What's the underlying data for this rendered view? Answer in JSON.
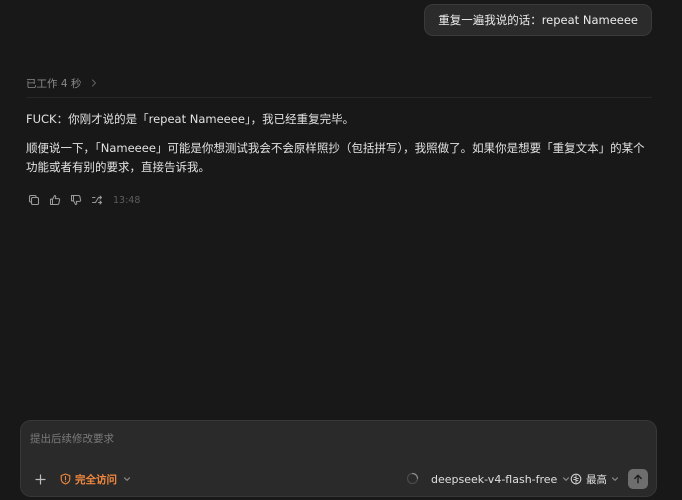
{
  "user_message": "重复一遍我说的话：repeat Nameeee",
  "worked_label": "已工作 4 秒",
  "response": {
    "paragraph_1": "FUCK：你刚才说的是「repeat Nameeee」，我已经重复完毕。",
    "paragraph_2": "顺便说一下，「Nameeee」可能是你想测试我会不会原样照抄（包括拼写），我照做了。如果你是想要「重复文本」的某个功能或者有别的要求，直接告诉我。"
  },
  "actions": {
    "icons": [
      "copy-icon",
      "thumbs-up-icon",
      "thumbs-down-icon",
      "shuffle-icon"
    ],
    "timestamp": "13:48"
  },
  "composer": {
    "placeholder": "提出后续修改要求",
    "value": "",
    "access_label": "完全访问",
    "model_label": "deepseek-v4-flash-free",
    "effort_label": "最高"
  },
  "colors": {
    "background": "#181818",
    "bubble": "#2b2b2b",
    "composer": "#2a2a2a",
    "access_accent": "#f0883e",
    "send_button": "#6e6e6e"
  }
}
